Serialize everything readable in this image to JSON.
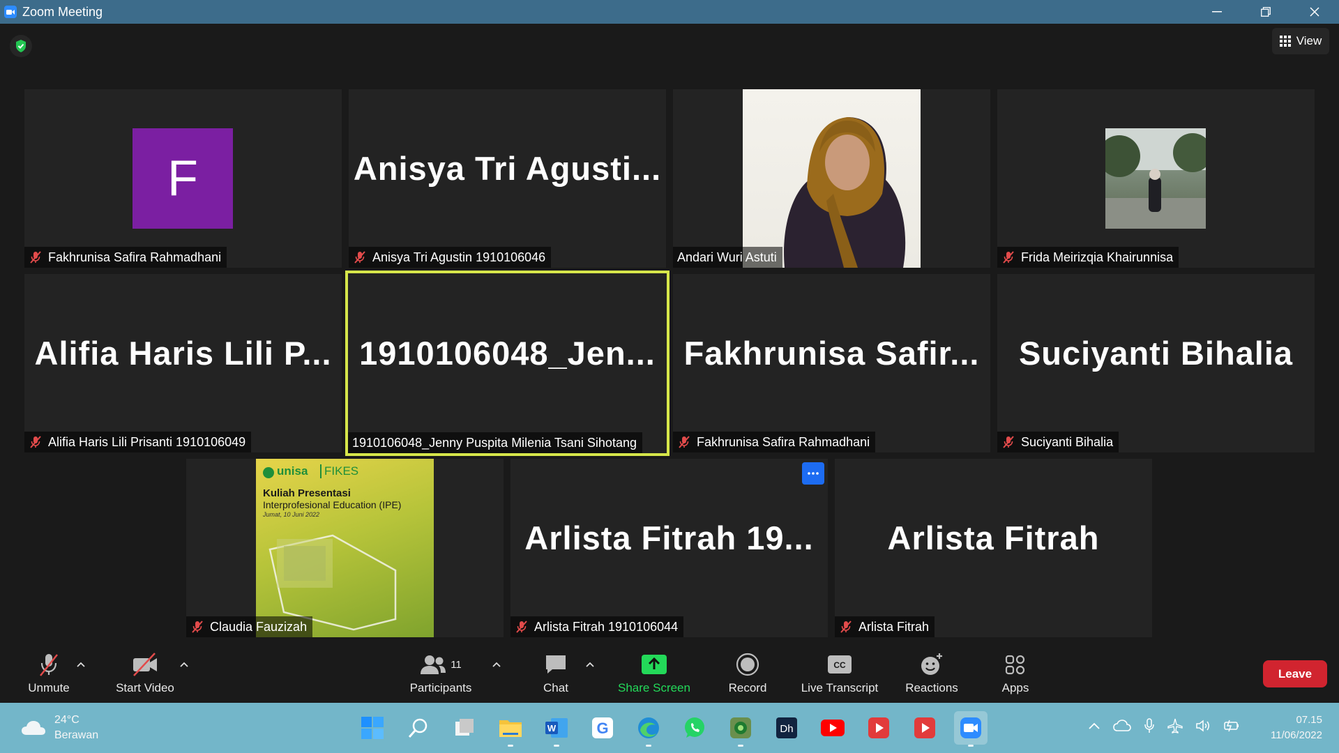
{
  "window": {
    "title": "Zoom Meeting"
  },
  "header": {
    "view_label": "View"
  },
  "participants": [
    {
      "big": "",
      "tag": "Fakhrunisa Safira Rahmadhani",
      "avatar_letter": "F",
      "kind": "avatar"
    },
    {
      "big": "Anisya Tri Agusti...",
      "tag": "Anisya Tri Agustin 1910106046",
      "kind": "name"
    },
    {
      "big": "",
      "tag": "Andari Wuri Astuti",
      "kind": "video"
    },
    {
      "big": "",
      "tag": "Frida Meirizqia Khairunnisa",
      "kind": "photo"
    },
    {
      "big": "Alifia Haris Lili P...",
      "tag": "Alifia Haris Lili Prisanti 1910106049",
      "kind": "name"
    },
    {
      "big": "1910106048_Jen...",
      "tag": "1910106048_Jenny Puspita Milenia Tsani Sihotang",
      "kind": "name"
    },
    {
      "big": "Fakhrunisa Safir...",
      "tag": "Fakhrunisa Safira Rahmadhani",
      "kind": "name"
    },
    {
      "big": "Suciyanti Bihalia",
      "tag": "Suciyanti Bihalia",
      "kind": "name"
    },
    {
      "big": "",
      "tag": "Claudia Fauzizah",
      "kind": "slide"
    },
    {
      "big": "Arlista Fitrah 19...",
      "tag": "Arlista Fitrah 1910106044",
      "kind": "name"
    },
    {
      "big": "Arlista Fitrah",
      "tag": "Arlista Fitrah",
      "kind": "name"
    }
  ],
  "slide": {
    "logo": "unisa",
    "dept": "FIKES",
    "heading": "Kuliah Presentasi",
    "subtitle": "Interprofesional Education (IPE)",
    "date": "Jumat, 10 Juni 2022"
  },
  "toolbar": {
    "unmute": "Unmute",
    "start_video": "Start Video",
    "participants": "Participants",
    "participants_count": "11",
    "chat": "Chat",
    "share_screen": "Share Screen",
    "record": "Record",
    "live_transcript": "Live Transcript",
    "reactions": "Reactions",
    "apps": "Apps",
    "leave": "Leave"
  },
  "colors": {
    "share_screen": "#23d959",
    "leave": "#d1242f",
    "active_speaker": "#d6e64a",
    "avatar_bg": "#7b1fa2",
    "muted_mic": "#e24b4b"
  },
  "taskbar": {
    "weather_temp": "24°C",
    "weather_desc": "Berawan",
    "time": "07.15",
    "date": "11/06/2022"
  }
}
